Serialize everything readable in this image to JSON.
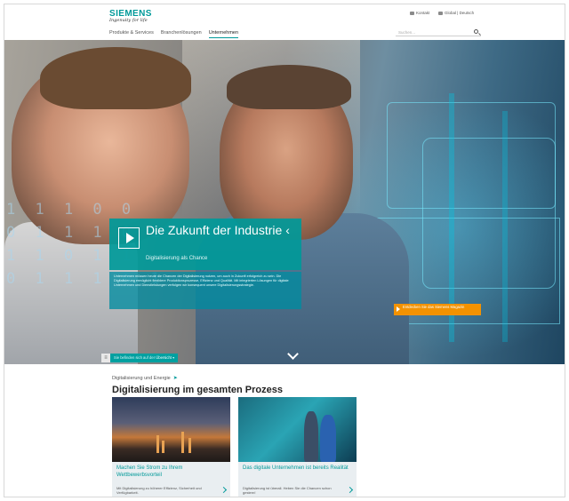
{
  "header": {
    "logo_text": "SIEMENS",
    "logo_tagline": "Ingenuity for life",
    "utility": {
      "contact": "Kontakt",
      "language": "Global | Deutsch"
    },
    "nav": [
      "Produkte & Services",
      "Branchenlösungen",
      "Unternehmen"
    ],
    "active_nav": "Unternehmen",
    "search_placeholder": "Suchen..."
  },
  "hero": {
    "binary_text": "1 1 1 0 0\n0 1 1 1 0 1\n1 1 0 1 1\n0 1 1 1 0 1",
    "teaser_title": "Die Zukunft der Industrie",
    "teaser_arrow": "‹",
    "teaser_subtitle": "Digitalisierung als Chance",
    "description": "Unternehmen müssen heute die Chancen der Digitalisierung nutzen, um auch in Zukunft erfolgreich zu sein. Die Digitalisierung ermöglicht flexiblere Produktionsprozesse, Effizienz und Qualität. Mit integrierten Lösungen für digitale Unternehmen und Dienstleistungen verfolgen wir konsequent unsere Digitalisierungsstrategie.",
    "cta_label": "Entdecken Sie das Siemens Magazin",
    "subbar_text": "Sie befinden sich auf der",
    "subbar_selected": "Übersicht"
  },
  "content": {
    "breadcrumb": "Digitalisierung und Energie",
    "heading": "Digitalisierung im gesamten Prozess",
    "cards": [
      {
        "title": "Machen Sie Strom zu Ihrem Wettbewerbsvorteil",
        "body": "Mit Digitalisierung zu höherer Effizienz, Sicherheit und Verfügbarkeit."
      },
      {
        "title": "Das digitale Unternehmen ist bereits Realität",
        "body": "Digitalisierung ist überall. Heben Sie die Chancen schon gestern!"
      }
    ]
  },
  "colors": {
    "brand": "#009999",
    "cta": "#f39200"
  },
  "icons": [
    "contact-icon",
    "globe-icon",
    "search-icon",
    "play-icon",
    "chevron-down-icon",
    "share-icon",
    "chevron-right-icon"
  ]
}
